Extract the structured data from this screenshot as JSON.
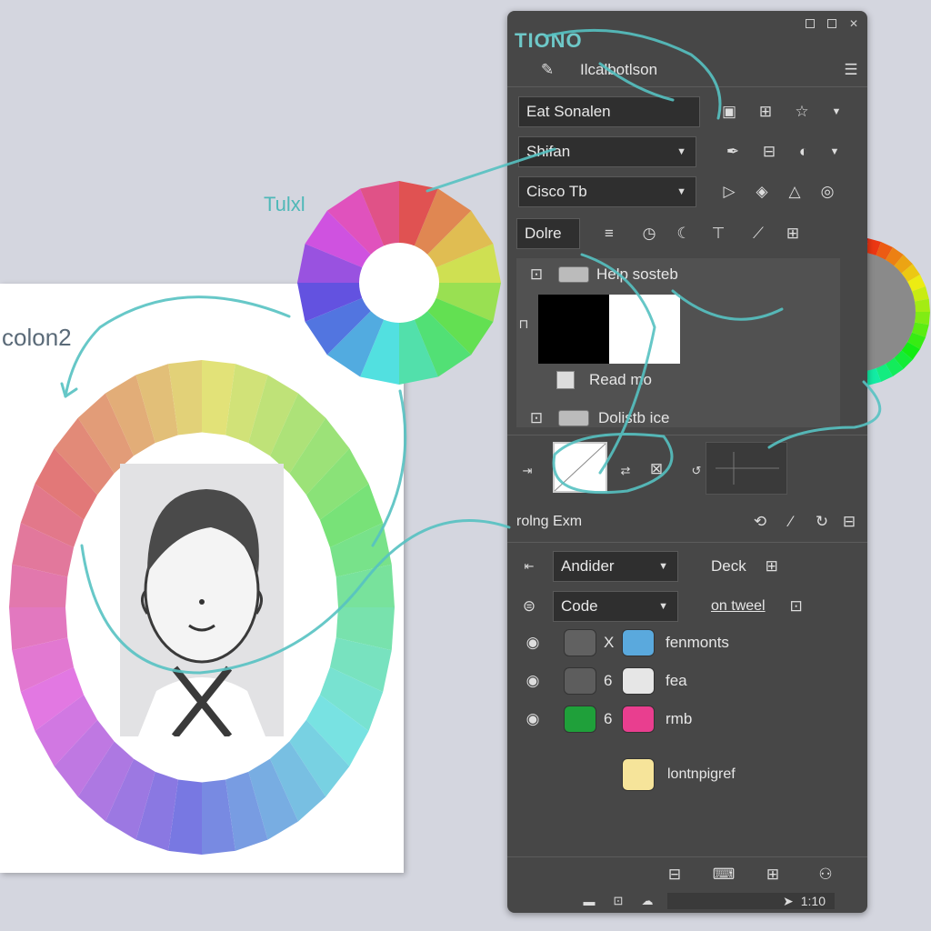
{
  "canvas": {
    "label": "colon2"
  },
  "floating": {
    "label": "Tulxl"
  },
  "panel": {
    "title": "TIONO",
    "header_text": "Ilcalbotlson",
    "menu_icon": "hamburger-icon",
    "row1": {
      "value": "Eat Sonalen"
    },
    "row2": {
      "value": "Shifan"
    },
    "row3": {
      "value": "Cisco Tb"
    },
    "row4": {
      "value": "Dolre"
    },
    "group": {
      "help_label": "Help sosteb",
      "read_label": "Read mo",
      "dolist_label": "Dolistb ice"
    },
    "section_label": "rolng Exm",
    "dropdown1": {
      "value": "Andider",
      "link": "Deck"
    },
    "dropdown2": {
      "value": "Code",
      "link": "on tweel"
    },
    "swatch_rows": [
      {
        "a": "#616161",
        "sym": "X",
        "b": "#5aa9dd",
        "label": "fenmonts"
      },
      {
        "a": "#5d5d5d",
        "sym": "6",
        "b": "#e6e6e6",
        "label": "fea"
      },
      {
        "a": "#1fa03a",
        "sym": "6",
        "b": "#e93e8f",
        "label": "rmb"
      }
    ],
    "single_swatch": {
      "color": "#f6e49a",
      "label": "lontnpigref"
    },
    "status": {
      "time": "1:10"
    }
  },
  "colors": {
    "accent": "#56c2c2",
    "panel_bg": "#474747"
  }
}
